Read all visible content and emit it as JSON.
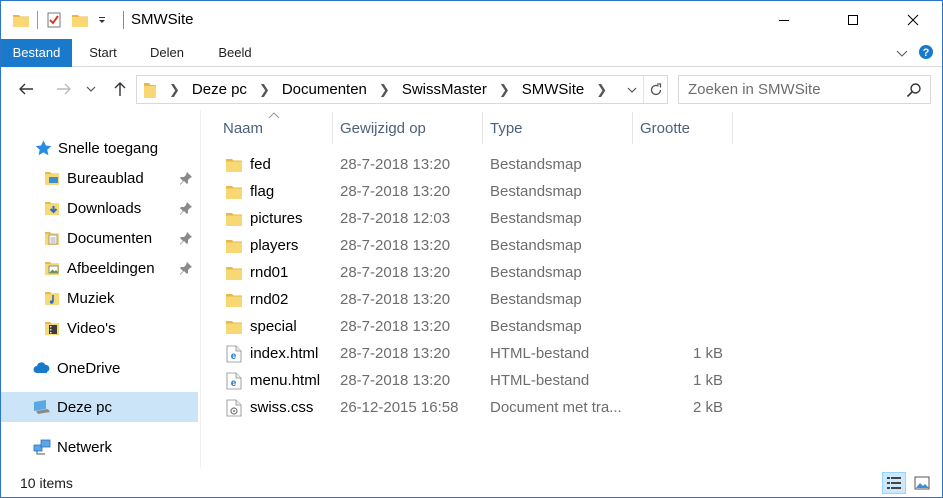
{
  "window": {
    "title": "SMWSite"
  },
  "qat": {
    "icons": [
      "folder-icon",
      "properties-icon",
      "new-folder-icon",
      "customize-dropdown-icon"
    ]
  },
  "ribbon": {
    "tabs": [
      "Bestand",
      "Start",
      "Delen",
      "Beeld"
    ],
    "accent_color": "#1979ca"
  },
  "address": {
    "crumbs": [
      "Deze pc",
      "Documenten",
      "SwissMaster",
      "SMWSite"
    ]
  },
  "search": {
    "placeholder": "Zoeken in SMWSite"
  },
  "nav": {
    "items": [
      {
        "label": "Snelle toegang",
        "icon": "star-icon"
      },
      {
        "label": "Bureaublad",
        "icon": "desktop-folder-icon",
        "pinned": true
      },
      {
        "label": "Downloads",
        "icon": "downloads-folder-icon",
        "pinned": true
      },
      {
        "label": "Documenten",
        "icon": "documents-folder-icon",
        "pinned": true
      },
      {
        "label": "Afbeeldingen",
        "icon": "pictures-folder-icon",
        "pinned": true
      },
      {
        "label": "Muziek",
        "icon": "music-folder-icon"
      },
      {
        "label": "Video's",
        "icon": "videos-folder-icon"
      },
      {
        "label": "OneDrive",
        "icon": "onedrive-cloud-icon"
      },
      {
        "label": "Deze pc",
        "icon": "this-pc-icon",
        "selected": true
      },
      {
        "label": "Netwerk",
        "icon": "network-icon"
      }
    ],
    "selected_color": "#cce4f7"
  },
  "columns": {
    "name": "Naam",
    "modified": "Gewijzigd op",
    "type": "Type",
    "size": "Grootte"
  },
  "files": [
    {
      "name": "fed",
      "modified": "28-7-2018 13:20",
      "type": "Bestandsmap",
      "size": "",
      "icon": "folder-icon"
    },
    {
      "name": "flag",
      "modified": "28-7-2018 13:20",
      "type": "Bestandsmap",
      "size": "",
      "icon": "folder-icon"
    },
    {
      "name": "pictures",
      "modified": "28-7-2018 12:03",
      "type": "Bestandsmap",
      "size": "",
      "icon": "folder-icon"
    },
    {
      "name": "players",
      "modified": "28-7-2018 13:20",
      "type": "Bestandsmap",
      "size": "",
      "icon": "folder-icon"
    },
    {
      "name": "rnd01",
      "modified": "28-7-2018 13:20",
      "type": "Bestandsmap",
      "size": "",
      "icon": "folder-icon"
    },
    {
      "name": "rnd02",
      "modified": "28-7-2018 13:20",
      "type": "Bestandsmap",
      "size": "",
      "icon": "folder-icon"
    },
    {
      "name": "special",
      "modified": "28-7-2018 13:20",
      "type": "Bestandsmap",
      "size": "",
      "icon": "folder-icon"
    },
    {
      "name": "index.html",
      "modified": "28-7-2018 13:20",
      "type": "HTML-bestand",
      "size": "1 kB",
      "icon": "edge-html-file-icon"
    },
    {
      "name": "menu.html",
      "modified": "28-7-2018 13:20",
      "type": "HTML-bestand",
      "size": "1 kB",
      "icon": "edge-html-file-icon"
    },
    {
      "name": "swiss.css",
      "modified": "26-12-2015 16:58",
      "type": "Document met tra...",
      "size": "2 kB",
      "icon": "css-file-icon"
    }
  ],
  "status": {
    "item_count": "10 items"
  }
}
